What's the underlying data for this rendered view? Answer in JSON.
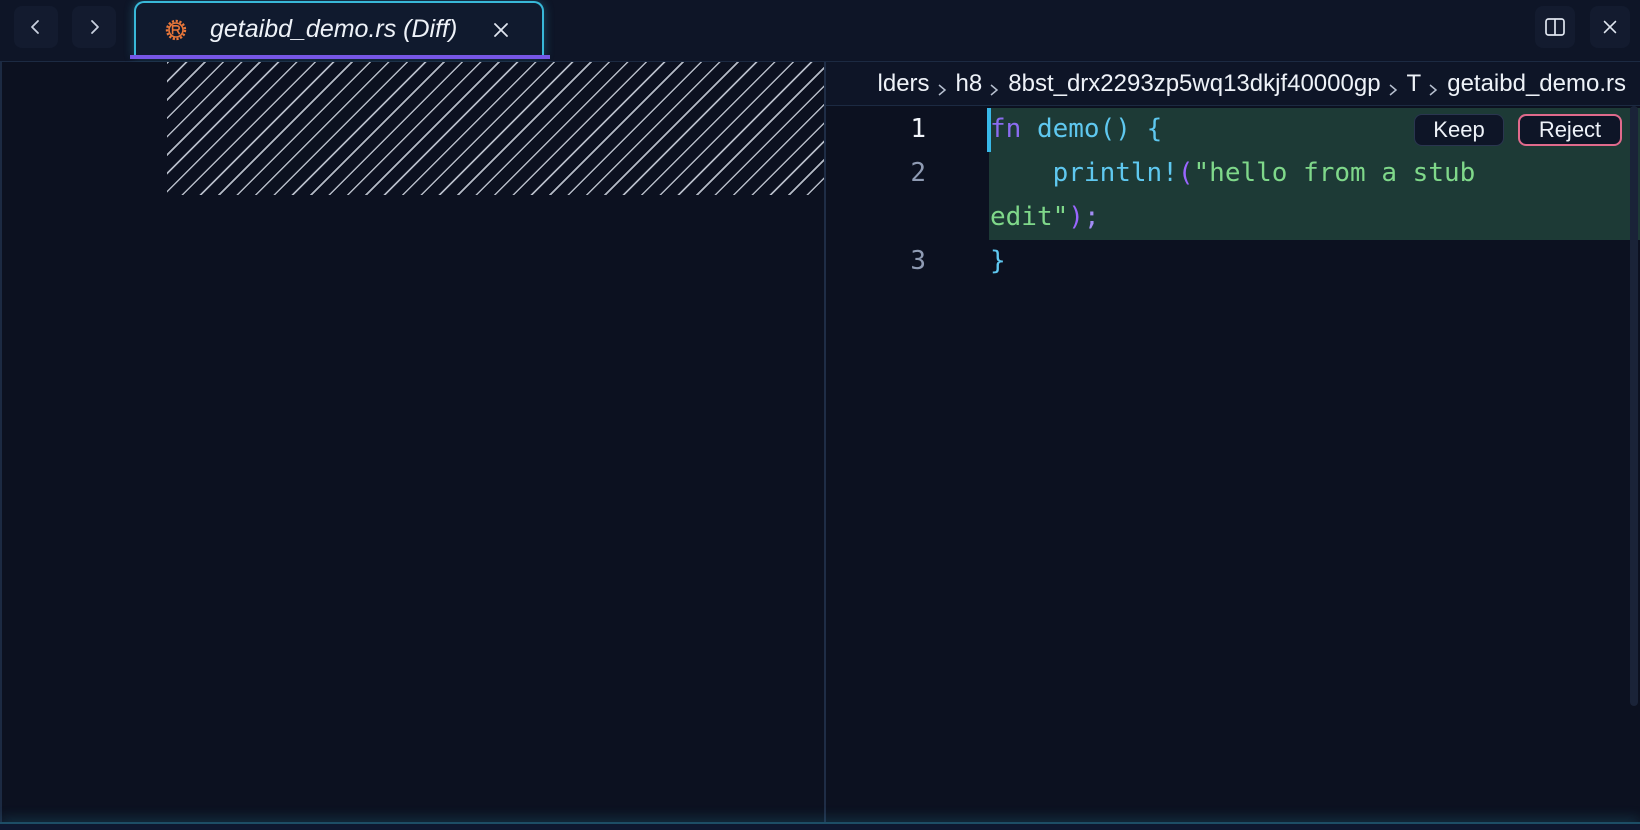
{
  "tabbar": {
    "back_icon": "chevron-left-icon",
    "forward_icon": "chevron-right-icon",
    "active_tab": {
      "title": "getaibd_demo.rs (Diff)",
      "icon": "rust-icon",
      "icon_color": "#e8773a",
      "close_icon": "close-icon"
    },
    "split_icon": "split-view-icon",
    "close_panel_icon": "close-icon"
  },
  "breadcrumb": {
    "items": [
      "lders",
      "h8",
      "8bst_drx2293zp5wq13dkjf40000gp",
      "T",
      "getaibd_demo.rs"
    ]
  },
  "editor": {
    "line_numbers": [
      "1",
      "2",
      "3"
    ],
    "lines": {
      "l1_kw": "fn",
      "l1_name": "demo",
      "l1_parens": "()",
      "l1_brace": "{",
      "l2_macro": "println!",
      "l2_open": "(",
      "l2_str_a": "\"hello from a stub",
      "l2_str_b": "edit\"",
      "l2_close": ")",
      "l2_semi": ";",
      "l3_brace": "}"
    },
    "actions": {
      "keep_label": "Keep",
      "reject_label": "Reject"
    },
    "colors": {
      "added_bg": "#1d3a36",
      "accent": "#38b8d8",
      "reject_border": "#e06a8c"
    }
  }
}
